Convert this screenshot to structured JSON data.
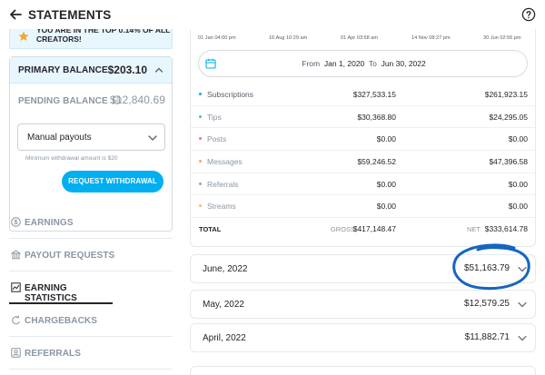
{
  "header": {
    "title": "STATEMENTS",
    "back_icon": "arrow-left-icon",
    "help_icon": "question-circle-icon"
  },
  "banner": {
    "text": "YOU ARE IN THE TOP 0.14% OF ALL CREATORS!",
    "icon": "star-icon",
    "star_color": "#f5a623"
  },
  "balance": {
    "primary_label": "PRIMARY BALANCE",
    "primary_value": "$203.10",
    "pending_label": "PENDING BALANCE",
    "pending_value": "$12,840.69",
    "payout_select": "Manual payouts",
    "min_note": "Minimum withdrawal amount is $20",
    "request_button": "REQUEST WITHDRAWAL"
  },
  "nav": [
    {
      "label": "EARNINGS",
      "icon": "dollar-circle-icon"
    },
    {
      "label": "PAYOUT REQUESTS",
      "icon": "bank-icon"
    },
    {
      "label": "EARNING STATISTICS",
      "icon": "chart-line-icon"
    },
    {
      "label": "CHARGEBACKS",
      "icon": "chargeback-icon"
    },
    {
      "label": "REFERRALS",
      "icon": "referral-icon"
    }
  ],
  "statistics": {
    "x_ticks": [
      "01 Jan 04:00 pm",
      "16 Aug 10:29 am",
      "01 Apr 03:58 am",
      "14 Nov 08:27 pm",
      "30 Jun 02:56 pm"
    ],
    "date_range": {
      "from_label": "From",
      "from": "Jan 1, 2020",
      "to_label": "To",
      "to": "Jun 30, 2022"
    },
    "rows": [
      {
        "name": "Subscriptions",
        "gross": "$327,533.15",
        "net": "$261,923.15",
        "color": "#00aff0"
      },
      {
        "name": "Tips",
        "gross": "$30,368.80",
        "net": "$24,295.05",
        "color": "#3bc9b0"
      },
      {
        "name": "Posts",
        "gross": "$0.00",
        "net": "$0.00",
        "color": "#f26b8a"
      },
      {
        "name": "Messages",
        "gross": "$59,246.52",
        "net": "$47,396.58",
        "color": "#f5a26b"
      },
      {
        "name": "Referrals",
        "gross": "$0.00",
        "net": "$0.00",
        "color": "#9aa5b0"
      },
      {
        "name": "Streams",
        "gross": "$0.00",
        "net": "$0.00",
        "color": "#f5c26b"
      }
    ],
    "total": {
      "label": "TOTAL",
      "gross_label": "GROSS",
      "gross": "$417,148.47",
      "net_label": "NET",
      "net": "$333,614.78"
    }
  },
  "months": [
    {
      "label": "June, 2022",
      "amount": "$51,163.79"
    },
    {
      "label": "May, 2022",
      "amount": "$12,579.25"
    },
    {
      "label": "April, 2022",
      "amount": "$11,882.71"
    }
  ],
  "colors": {
    "accent": "#00aff0",
    "annotation": "#1565c0"
  }
}
